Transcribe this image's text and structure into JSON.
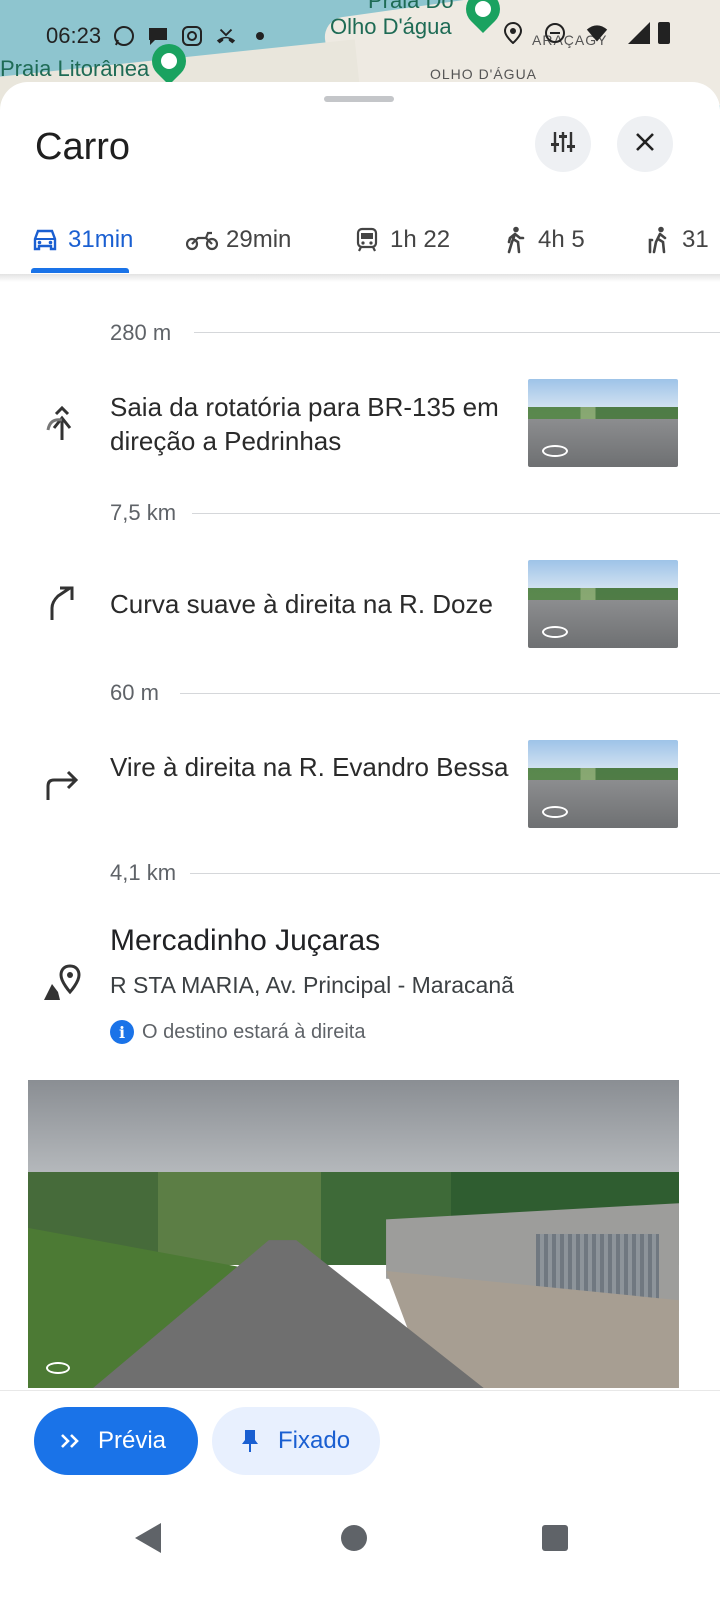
{
  "map": {
    "labels": [
      "Praia Do",
      "Olho D'água",
      "Praia Litorânea",
      "OLHO D'ÁGUA",
      "ARAÇAGY"
    ]
  },
  "status_bar": {
    "time": "06:23",
    "icons": [
      "whatsapp-icon",
      "chat-icon",
      "instagram-icon",
      "missed-call-icon",
      "dot-icon",
      "location-icon",
      "dnd-icon",
      "wifi-icon",
      "signal-icon",
      "battery-icon"
    ]
  },
  "header": {
    "title": "Carro",
    "options_icon": "tune-icon",
    "close_icon": "close-icon"
  },
  "tabs": [
    {
      "label": "31min",
      "icon": "car-icon",
      "active": true
    },
    {
      "label": "29min",
      "icon": "motorcycle-icon",
      "active": false
    },
    {
      "label": "1h 22",
      "icon": "transit-icon",
      "active": false
    },
    {
      "label": "4h 5",
      "icon": "walk-icon",
      "active": false
    },
    {
      "label": "31",
      "icon": "ride-icon",
      "active": false
    }
  ],
  "steps": [
    {
      "distance_before": "280 m",
      "instruction": "Saia da rotatória para BR-135 em direção a Pedrinhas",
      "icon": "roundabout-exit-icon"
    },
    {
      "distance_before": "7,5 km",
      "instruction": "Curva suave à direita na R. Doze",
      "icon": "slight-right-icon"
    },
    {
      "distance_before": "60 m",
      "instruction": "Vire à direita na R. Evandro Bessa",
      "icon": "turn-right-icon"
    }
  ],
  "final_distance": "4,1 km",
  "destination": {
    "name": "Mercadinho Juçaras",
    "address": "R STA MARIA, Av. Principal - Maracanã",
    "note": "O destino estará à direita",
    "icon": "destination-flag-icon"
  },
  "actions": {
    "preview_label": "Prévia",
    "pinned_label": "Fixado"
  },
  "colors": {
    "accent": "#1a73e8",
    "accent_light": "#e8f0fe",
    "map_water": "#8ec5cf"
  }
}
